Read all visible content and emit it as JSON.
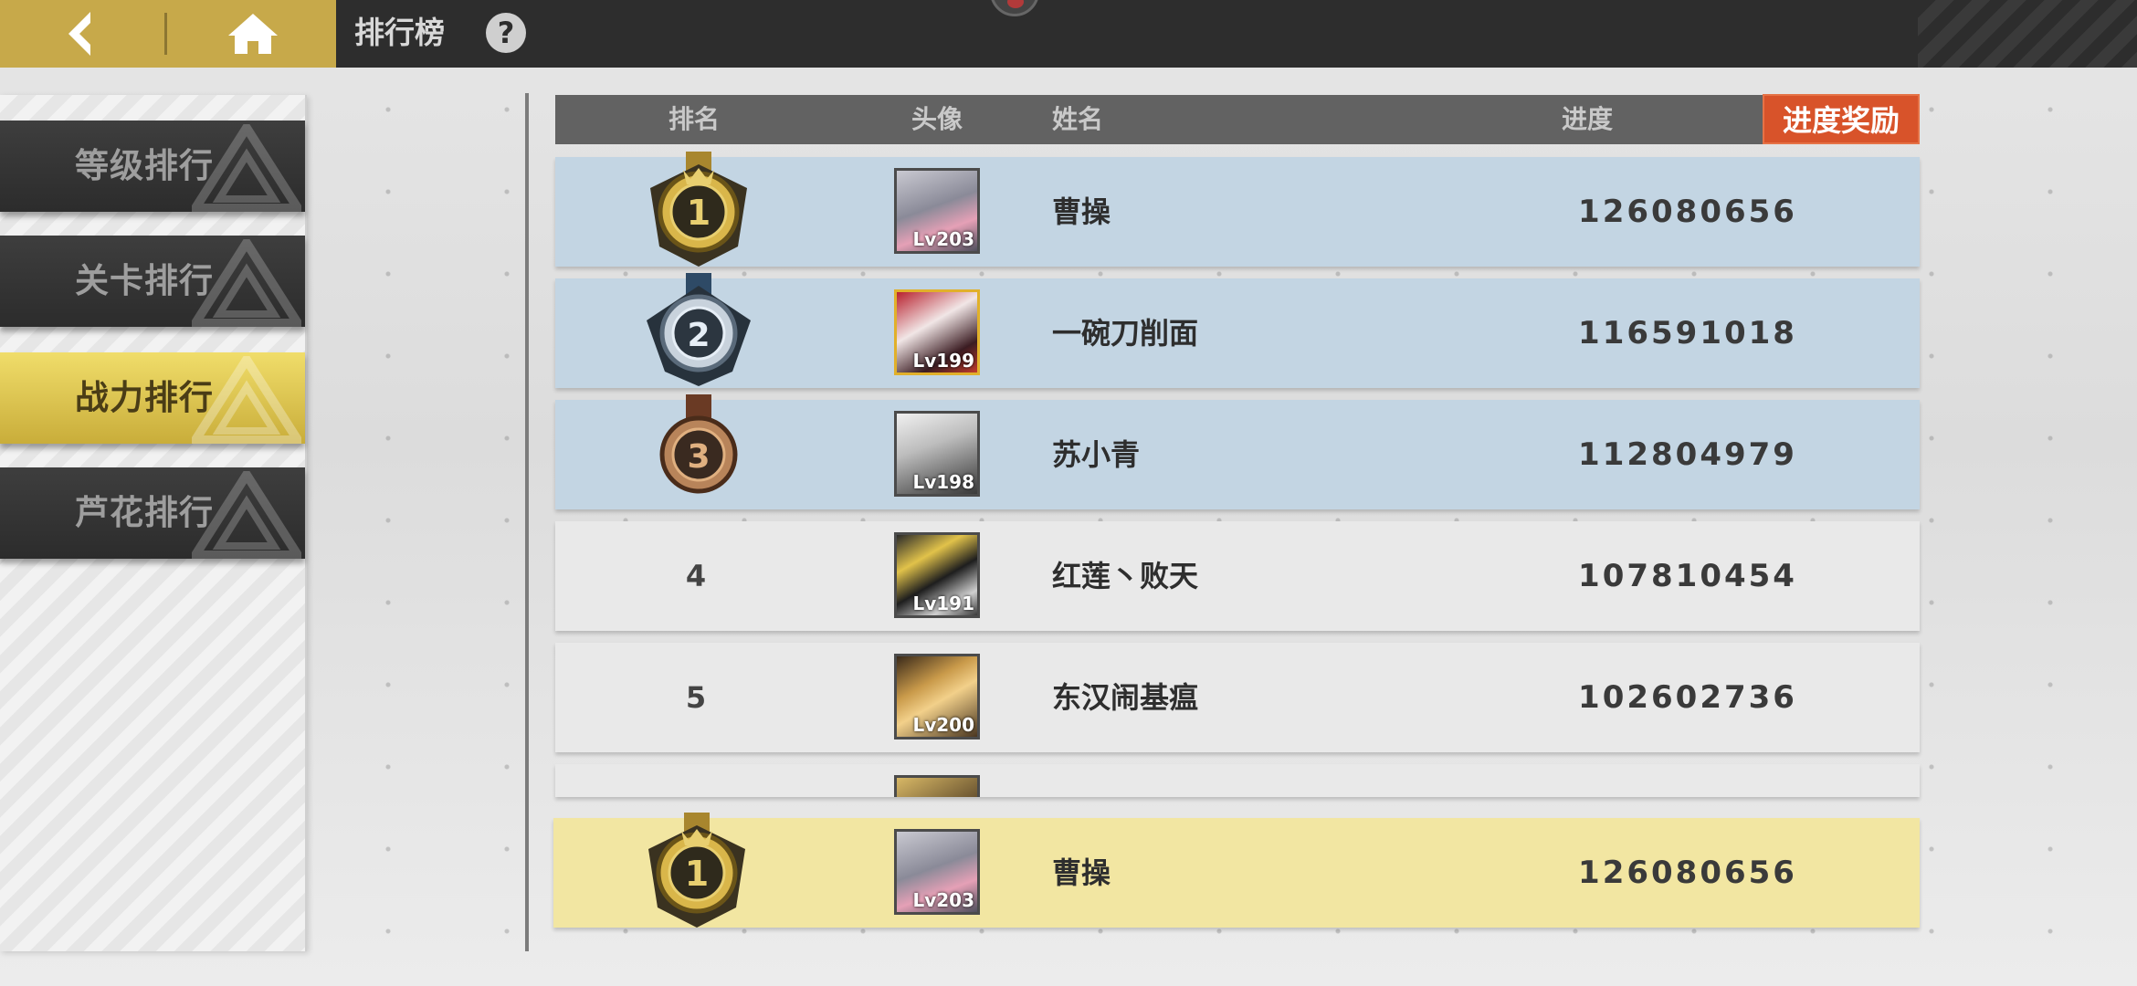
{
  "header": {
    "title": "排行榜",
    "help_glyph": "?",
    "back_icon": "back-arrow-icon",
    "home_icon": "home-icon"
  },
  "tabs": [
    {
      "label": "等级排行",
      "active": false
    },
    {
      "label": "关卡排行",
      "active": false
    },
    {
      "label": "战力排行",
      "active": true
    },
    {
      "label": "芦花排行",
      "active": false
    }
  ],
  "table": {
    "columns": {
      "rank": "排名",
      "avatar": "头像",
      "name": "姓名",
      "progress": "进度"
    },
    "reward_button": "进度奖励",
    "rows": [
      {
        "rank": "1",
        "name": "曹操",
        "level": "Lv203",
        "score": "126080656"
      },
      {
        "rank": "2",
        "name": "一碗刀削面",
        "level": "Lv199",
        "score": "116591018"
      },
      {
        "rank": "3",
        "name": "苏小青",
        "level": "Lv198",
        "score": "112804979"
      },
      {
        "rank": "4",
        "name": "红莲丶败天",
        "level": "Lv191",
        "score": "107810454"
      },
      {
        "rank": "5",
        "name": "东汉闹基瘟",
        "level": "Lv200",
        "score": "102602736"
      }
    ],
    "my_row": {
      "rank": "1",
      "name": "曹操",
      "level": "Lv203",
      "score": "126080656"
    }
  },
  "colors": {
    "accent_gold": "#c7a94a",
    "reward_orange": "#d8532a",
    "top3_row": "#c3d5e3",
    "normal_row": "#e9e9e9",
    "my_row": "#f2e6a2"
  }
}
